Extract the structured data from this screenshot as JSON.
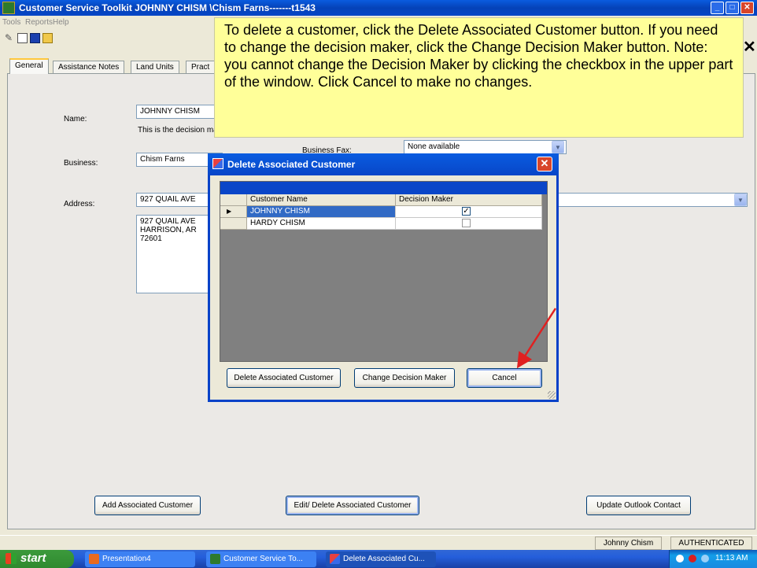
{
  "window": {
    "title": "Customer Service Toolkit    JOHNNY CHISM    \\Chism  Farns-------t1543",
    "min": "_",
    "max": "□",
    "close": "✕"
  },
  "menu": [
    "Tools",
    "Reports",
    "Help"
  ],
  "main_close": "✕",
  "tabs": [
    "General",
    "Assistance Notes",
    "Land Units",
    "Pract"
  ],
  "general": {
    "name_label": "Name:",
    "name_value": "JOHNNY CHISM",
    "decision_note": "This is the decision maker",
    "business_label": "Business:",
    "business_value": "Chism Farns",
    "business_fax_label": "Business Fax:",
    "business_fax_value": "None available",
    "address_label": "Address:",
    "address_value": "927 QUAIL AVE",
    "address_block": "927 QUAIL AVE\nHARRISON, AR\n72601"
  },
  "callout": "To delete a customer, click the Delete Associated Customer button. If you need to change the decision maker, click the Change Decision Maker button. Note: you cannot change the Decision Maker by clicking the checkbox in the upper part of the window. Click Cancel to make no changes.",
  "dialog": {
    "title": "Delete Associated Customer",
    "close": "✕",
    "columns": [
      "Customer Name",
      "Decision Maker"
    ],
    "rows": [
      {
        "marker": "▶",
        "name": "JOHNNY CHISM",
        "decision_maker": true,
        "check": "✓"
      },
      {
        "marker": "",
        "name": "HARDY CHISM",
        "decision_maker": false,
        "check": ""
      }
    ],
    "buttons": {
      "delete": "Delete Associated Customer",
      "change": "Change Decision Maker",
      "cancel": "Cancel"
    }
  },
  "bottom_buttons": {
    "add": "Add Associated Customer",
    "edit": "Edit/ Delete Associated Customer",
    "update": "Update Outlook Contact"
  },
  "status": {
    "user": "Johnny Chism",
    "auth": "AUTHENTICATED"
  },
  "taskbar": {
    "start": "start",
    "tasks": [
      "Presentation4",
      "Customer Service To...",
      "Delete Associated Cu..."
    ],
    "clock": "11:13 AM"
  },
  "colors": {
    "accent_arrow": "#e02020",
    "callout_bg": "#ffff99",
    "selection": "#316ac5"
  }
}
